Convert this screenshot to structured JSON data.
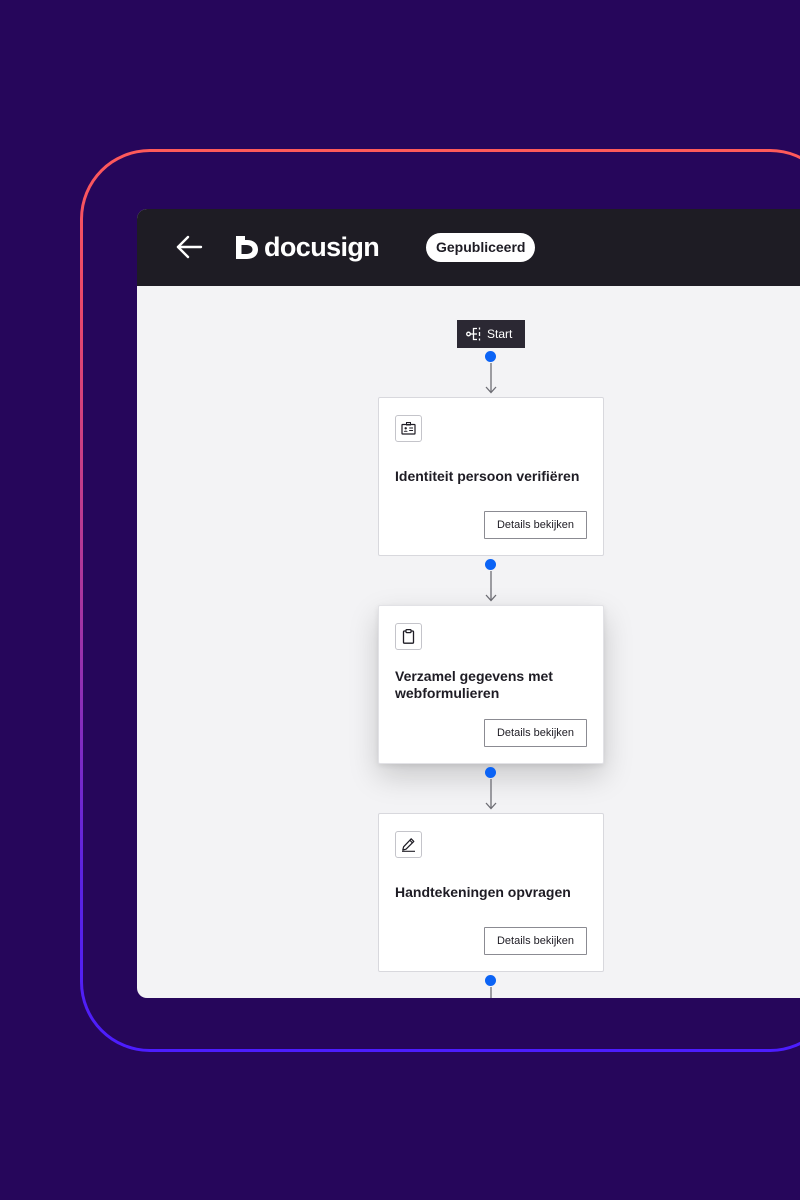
{
  "header": {
    "logo_text": "docusign",
    "status_badge": "Gepubliceerd",
    "back_icon": "arrow-left-icon",
    "logo_icon": "docusign-mark-icon"
  },
  "workflow": {
    "start_label": "Start",
    "start_icon": "workflow-start-icon",
    "steps": [
      {
        "title": "Identiteit persoon verifiëren",
        "button_label": "Details bekijken",
        "icon": "id-card-icon"
      },
      {
        "title": "Verzamel gegevens met webformulieren",
        "button_label": "Details bekijken",
        "icon": "clipboard-icon"
      },
      {
        "title": "Handtekeningen opvragen",
        "button_label": "Details bekijken",
        "icon": "signature-pen-icon"
      }
    ]
  },
  "colors": {
    "background": "#26065b",
    "top_bar": "#1e1c24",
    "canvas": "#f3f3f5",
    "connector": "#0b63f5",
    "outline_top": "#ff5a5a",
    "outline_bottom": "#4c1dff"
  }
}
